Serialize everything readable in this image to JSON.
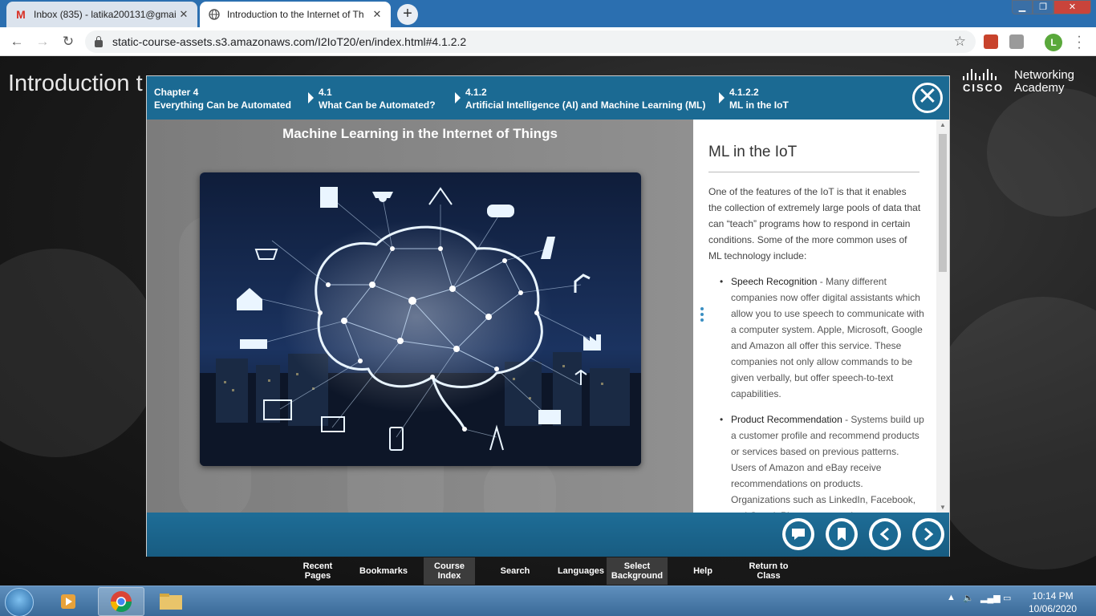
{
  "browser": {
    "tabs": [
      {
        "title": "Inbox (835) - latika200131@gmai",
        "icon": "gmail-icon",
        "active": false
      },
      {
        "title": "Introduction to the Internet of Th",
        "icon": "globe-icon",
        "active": true
      }
    ],
    "url": "static-course-assets.s3.amazonaws.com/I2IoT20/en/index.html#4.1.2.2",
    "profile_initial": "L"
  },
  "page": {
    "title": "Introduction t",
    "brand": {
      "logo": "CISCO",
      "line1": "Networking",
      "line2": "Academy"
    }
  },
  "breadcrumb": [
    {
      "num": "Chapter 4",
      "label": "Everything Can be Automated"
    },
    {
      "num": "4.1",
      "label": "What Can be Automated?"
    },
    {
      "num": "4.1.2",
      "label": "Artificial Intelligence (AI) and Machine Learning (ML)"
    },
    {
      "num": "4.1.2.2",
      "label": "ML in the IoT"
    }
  ],
  "figure": {
    "title": "Machine Learning in the Internet of Things"
  },
  "content": {
    "heading": "ML in the IoT",
    "intro": "One of the features of the IoT is that it enables the collection of extremely large pools of data that can “teach” programs how to respond in certain conditions. Some of the more common uses of ML technology include:",
    "items": [
      {
        "term": "Speech Recognition",
        "text": " - Many different companies now offer digital assistants which allow you to use speech to communicate with a computer system. Apple, Microsoft, Google and Amazon all offer this service. These companies not only allow commands to be given verbally, but offer speech-to-text capabilities."
      },
      {
        "term": "Product Recommendation",
        "text": " - Systems build up a customer profile and recommend products or services based on previous patterns. Users of Amazon and eBay receive recommendations on products. Organizations such as LinkedIn, Facebook, and GooglePlus recommend"
      }
    ]
  },
  "footer_buttons": [
    "comment-icon",
    "bookmark-icon",
    "previous-icon",
    "next-icon"
  ],
  "bottom_nav": [
    {
      "label": "Recent Pages",
      "selected": false
    },
    {
      "label": "Bookmarks",
      "selected": false
    },
    {
      "label": "Course Index",
      "selected": true
    },
    {
      "label": "Search",
      "selected": false
    },
    {
      "label": "Languages",
      "selected": false
    },
    {
      "label": "Select Background",
      "selected": false
    },
    {
      "label": "Help",
      "selected": false
    },
    {
      "label": "Return to Class",
      "selected": false
    }
  ],
  "taskbar": {
    "time": "10:14 PM",
    "date": "10/06/2020"
  },
  "colors": {
    "accent": "#1b6a93",
    "tab_bar": "#2b6fb0",
    "taskbar": "#4a7aa8"
  }
}
